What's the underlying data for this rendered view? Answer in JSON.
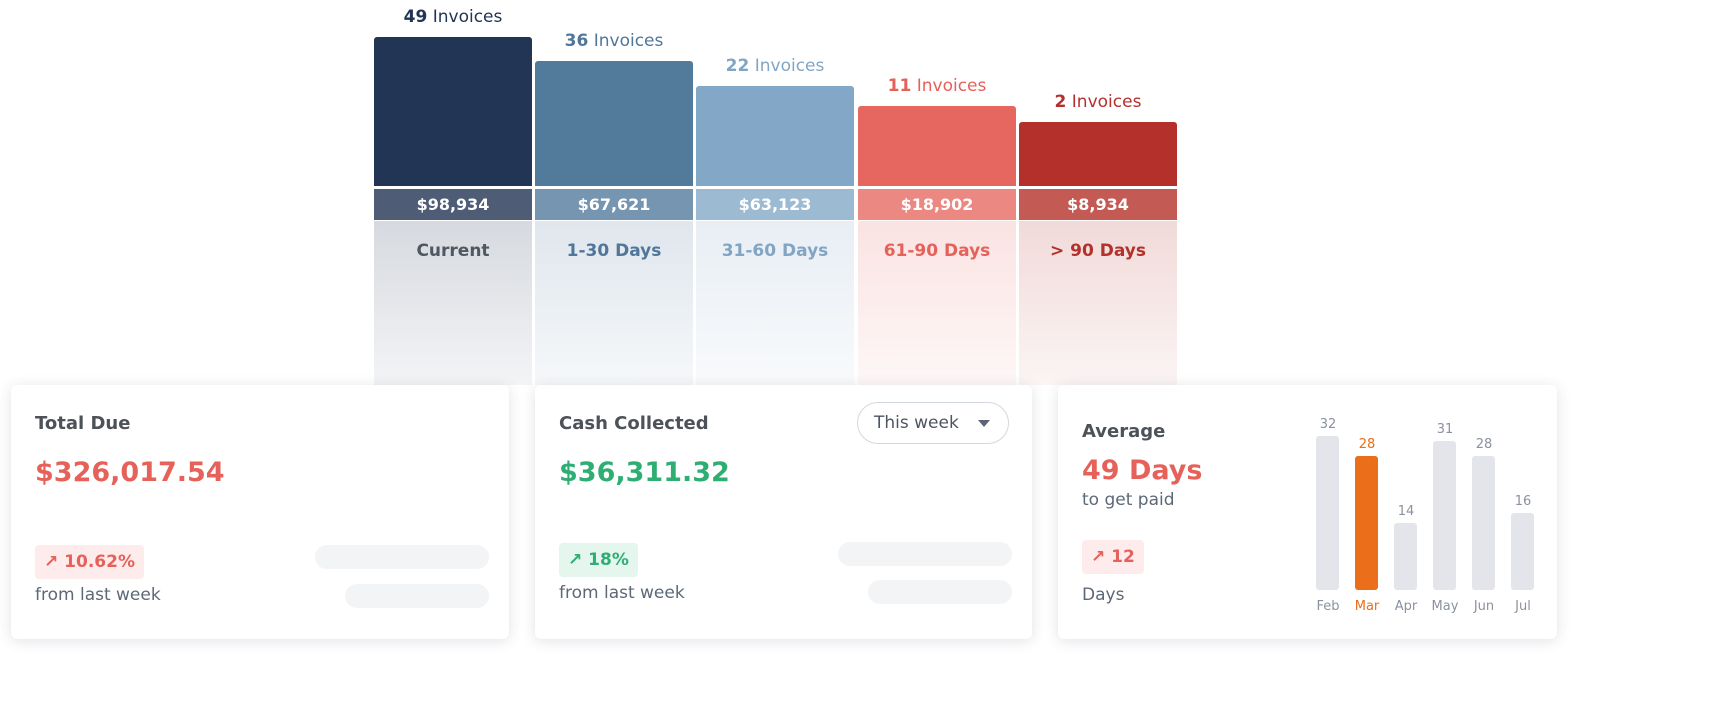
{
  "aging": {
    "invoices_word": "Invoices",
    "buckets": [
      {
        "label": "Current",
        "count": "49",
        "amount": "$98,934",
        "color": "#233554",
        "band": "#4e5c76",
        "label_color": "#4f5761",
        "fade": "#d6d9df",
        "count_color": "#233554"
      },
      {
        "label": "1-30 Days",
        "count": "36",
        "amount": "$67,621",
        "color": "#527a9b",
        "band": "#7595b0",
        "label_color": "#50769a",
        "fade": "#dfe6ed",
        "count_color": "#50769a"
      },
      {
        "label": "31-60 Days",
        "count": "22",
        "amount": "$63,123",
        "color": "#82a7c7",
        "band": "#9dbad3",
        "label_color": "#82a5c4",
        "fade": "#e8eef4",
        "count_color": "#82a5c4"
      },
      {
        "label": "61-90 Days",
        "count": "11",
        "amount": "$18,902",
        "color": "#e5675f",
        "band": "#eb8882",
        "label_color": "#e5615a",
        "fade": "#fae3e2",
        "count_color": "#e5615a"
      },
      {
        "label": "> 90 Days",
        "count": "2",
        "amount": "$8,934",
        "color": "#b3302b",
        "band": "#c45a54",
        "label_color": "#b3302b",
        "fade": "#f1dad9",
        "count_color": "#b3302b"
      }
    ]
  },
  "total_due": {
    "title": "Total Due",
    "value": "$326,017.54",
    "change": "10.62%",
    "change_sub": "from last week",
    "color": "#e5615a"
  },
  "cash_collected": {
    "title": "Cash Collected",
    "period": "This week",
    "value": "$36,311.32",
    "change": "18%",
    "change_sub": "from last week",
    "color": "#2fae74"
  },
  "average": {
    "title": "Average",
    "value": "49 Days",
    "sub": "to get paid",
    "change": "12",
    "change_sub": "Days",
    "highlight_color": "#eb6e1a"
  },
  "chart_data": [
    {
      "type": "bar",
      "categories": [
        "Current",
        "1-30 Days",
        "31-60 Days",
        "61-90 Days",
        "> 90 Days"
      ],
      "series": [
        {
          "name": "Invoices",
          "values": [
            49,
            36,
            22,
            11,
            2
          ]
        }
      ],
      "amounts": [
        "$98,934",
        "$67,621",
        "$63,123",
        "$18,902",
        "$8,934"
      ]
    },
    {
      "type": "bar",
      "categories": [
        "Feb",
        "Mar",
        "Apr",
        "May",
        "Jun",
        "Jul"
      ],
      "values": [
        32,
        28,
        14,
        31,
        28,
        16
      ],
      "highlight": "Mar"
    }
  ]
}
